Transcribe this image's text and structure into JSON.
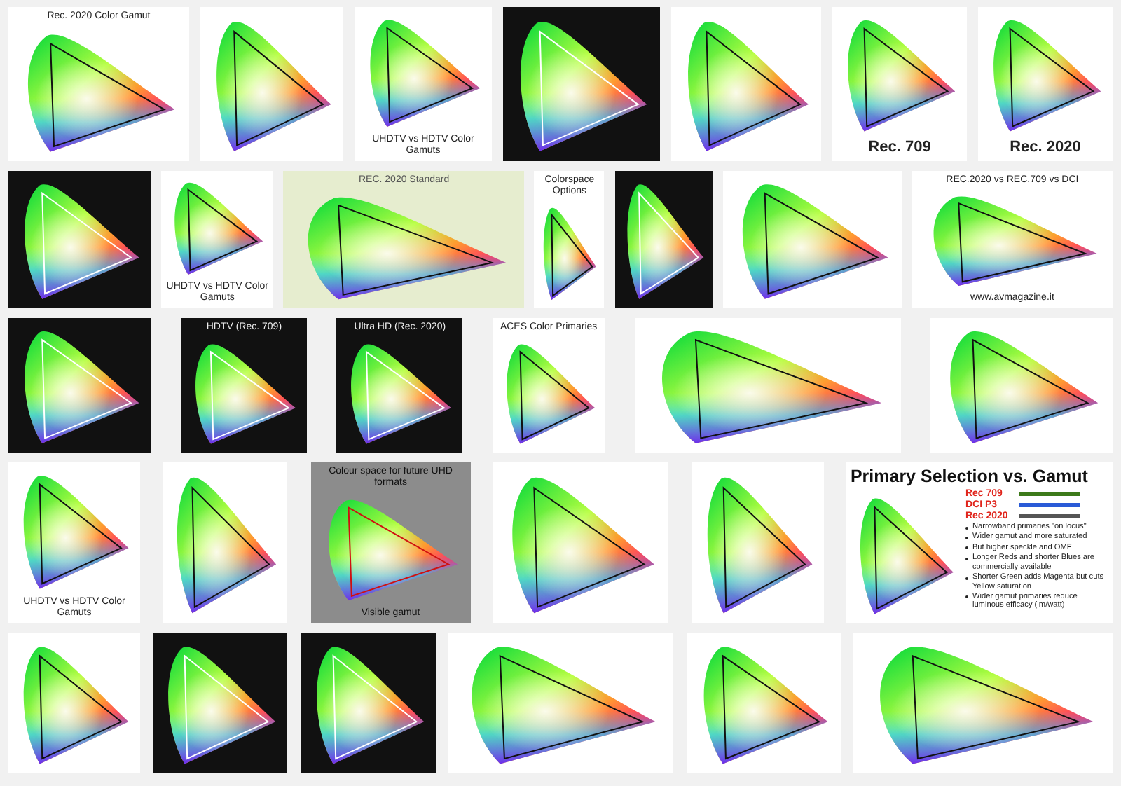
{
  "rows": [
    {
      "thumbs": [
        {
          "kind": "light",
          "title": "Rec. 2020 Color Gamut"
        },
        {
          "kind": "light"
        },
        {
          "kind": "light",
          "footer": "UHDTV vs HDTV Color Gamuts"
        },
        {
          "kind": "dark"
        },
        {
          "kind": "light"
        },
        {
          "kind": "light",
          "footer": "Rec. 709"
        },
        {
          "kind": "light",
          "footer": "Rec. 2020"
        }
      ]
    },
    {
      "thumbs": [
        {
          "kind": "dark"
        },
        {
          "kind": "light",
          "footer": "UHDTV vs HDTV Color Gamuts"
        },
        {
          "kind": "green",
          "title": "REC. 2020 Standard"
        },
        {
          "kind": "light",
          "title": "Colorspace Options"
        },
        {
          "kind": "dark"
        },
        {
          "kind": "light"
        },
        {
          "kind": "light",
          "title": "REC.2020 vs REC.709 vs DCI",
          "footer": "www.avmagazine.it"
        }
      ]
    },
    {
      "thumbs": [
        {
          "kind": "dark"
        },
        {
          "kind": "dark",
          "title": "HDTV (Rec. 709)"
        },
        {
          "kind": "dark",
          "title": "Ultra HD (Rec. 2020)"
        },
        {
          "kind": "light",
          "title": "ACES Color Primaries"
        },
        {
          "kind": "light"
        },
        {
          "kind": "light"
        }
      ]
    },
    {
      "thumbs": [
        {
          "kind": "light",
          "footer": "UHDTV vs HDTV Color Gamuts"
        },
        {
          "kind": "light"
        },
        {
          "kind": "gray",
          "title": "Colour space for future UHD formats",
          "footer": "Visible gamut"
        },
        {
          "kind": "light"
        },
        {
          "kind": "light"
        },
        {
          "kind": "slide",
          "title": "Primary Selection vs. Gamut",
          "legend": [
            {
              "label": "Rec 709",
              "color": "#3d7a1a"
            },
            {
              "label": "DCI P3",
              "color": "#2a5bd7"
            },
            {
              "label": "Rec 2020",
              "color": "#555555"
            }
          ],
          "bullets": [
            "Narrowband primaries \"on locus\"",
            "Wider gamut and more saturated",
            "But higher speckle and OMF",
            "Longer Reds and shorter Blues are commercially available",
            "Shorter Green adds Magenta but cuts Yellow saturation",
            "Wider gamut primaries reduce luminous efficacy (lm/watt)"
          ]
        }
      ]
    },
    {
      "thumbs": [
        {
          "kind": "light"
        },
        {
          "kind": "dark"
        },
        {
          "kind": "dark"
        },
        {
          "kind": "light"
        },
        {
          "kind": "light"
        },
        {
          "kind": "light"
        }
      ]
    }
  ]
}
